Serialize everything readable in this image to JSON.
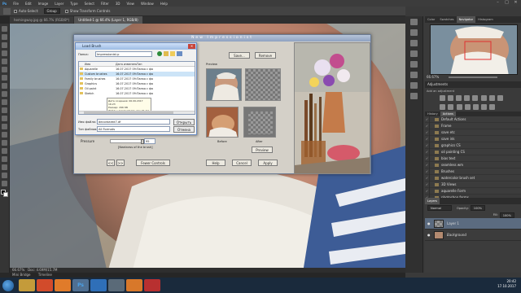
{
  "menu": [
    "Ps",
    "File",
    "Edit",
    "Image",
    "Layer",
    "Type",
    "Select",
    "Filter",
    "3D",
    "View",
    "Window",
    "Help"
  ],
  "options": {
    "auto_select_label": "Auto-Select:",
    "auto_select_value": "Group",
    "transform_label": "Show Transform Controls",
    "workspace": "Essentials"
  },
  "doc_tabs": [
    "hemingway.jpg @ 66.7% (RGB/8*)",
    "Untitled-1 @ 66.4% (Layer 1, RGB/8)"
  ],
  "status": {
    "zoom": "66.67%",
    "doc": "Doc: 4.69M/15.7M"
  },
  "mini_bridge_tabs": [
    "Mini Bridge",
    "Timeline"
  ],
  "panel_tabs_top": [
    "Color",
    "Swatches",
    "Navigator",
    "Histogram"
  ],
  "navigator_zoom": "66.67%",
  "adjustments": {
    "title": "Adjustments",
    "subtitle": "Add an adjustment"
  },
  "panel_tabs_mid": [
    "History",
    "Actions"
  ],
  "actions": [
    "Default Actions",
    "Frame",
    "save etc",
    "save ink",
    "graphics CS",
    "oil painting CS",
    "bias text",
    "seamless wm",
    "Brushes",
    "watercolor brush set",
    "3D Views",
    "aquarelle Form",
    "photoshop forms"
  ],
  "layers": {
    "title": "Layers",
    "mode": "Normal",
    "opacity_label": "Opacity:",
    "opacity": "100%",
    "fill_label": "Fill:",
    "fill": "100%",
    "rows": [
      {
        "name": "Layer 1",
        "visible": true
      },
      {
        "name": "Background",
        "visible": true
      }
    ]
  },
  "plugin": {
    "title": "New Impressionist",
    "save": "Save...",
    "remove": "Remove",
    "preview": "Preview",
    "before": "Before",
    "after": "After",
    "preview_btn": "Preview",
    "pressure_label": "Pressure",
    "pressure_value": "95",
    "pressure_note": "[Neatness of the brush]",
    "fewer_controls": "Fewer Controls",
    "help": "Help",
    "cancel": "Cancel",
    "apply": "Apply",
    "nav_prev": "<<",
    "nav_next": ">>"
  },
  "load_brush": {
    "title": "Load Brush",
    "folder_label": "Папка:",
    "folder": "Impressionist.p",
    "columns": [
      "Имя",
      "Дата изменения",
      "Тип"
    ],
    "files": [
      {
        "name": "Aquarelle",
        "date": "16.07.2017 09:32",
        "type": "Папка с файлам"
      },
      {
        "name": "Custom brushes",
        "date": "16.07.2017 09:33",
        "type": "Папка с файлам"
      },
      {
        "name": "Family brushes",
        "date": "16.07.2017 09:33",
        "type": "Папка с файлам"
      },
      {
        "name": "Graphics",
        "date": "16.07.2017 09:34",
        "type": "Папка с файлам"
      },
      {
        "name": "Oil paint",
        "date": "16.07.2017 09:34",
        "type": "Папка с файлам"
      },
      {
        "name": "Sketch",
        "date": "16.07.2017 09:34",
        "type": "Папка с файлам"
      }
    ],
    "tooltip": [
      "Дата создания: 06.06.2017 16:23",
      "Размер: 296 КБ",
      "Файлы: Acrylic 01.brl, Aqu 01.brl, Aqu 02.brl"
    ],
    "filename_label": "Имя файла:",
    "filename": "decordared7.df",
    "filetype_label": "Тип файлов:",
    "filetype": "All Formats",
    "open": "Открыть",
    "cancel": "Отмена"
  },
  "taskbar": {
    "time": "20:42",
    "date": "17.10.2017"
  }
}
